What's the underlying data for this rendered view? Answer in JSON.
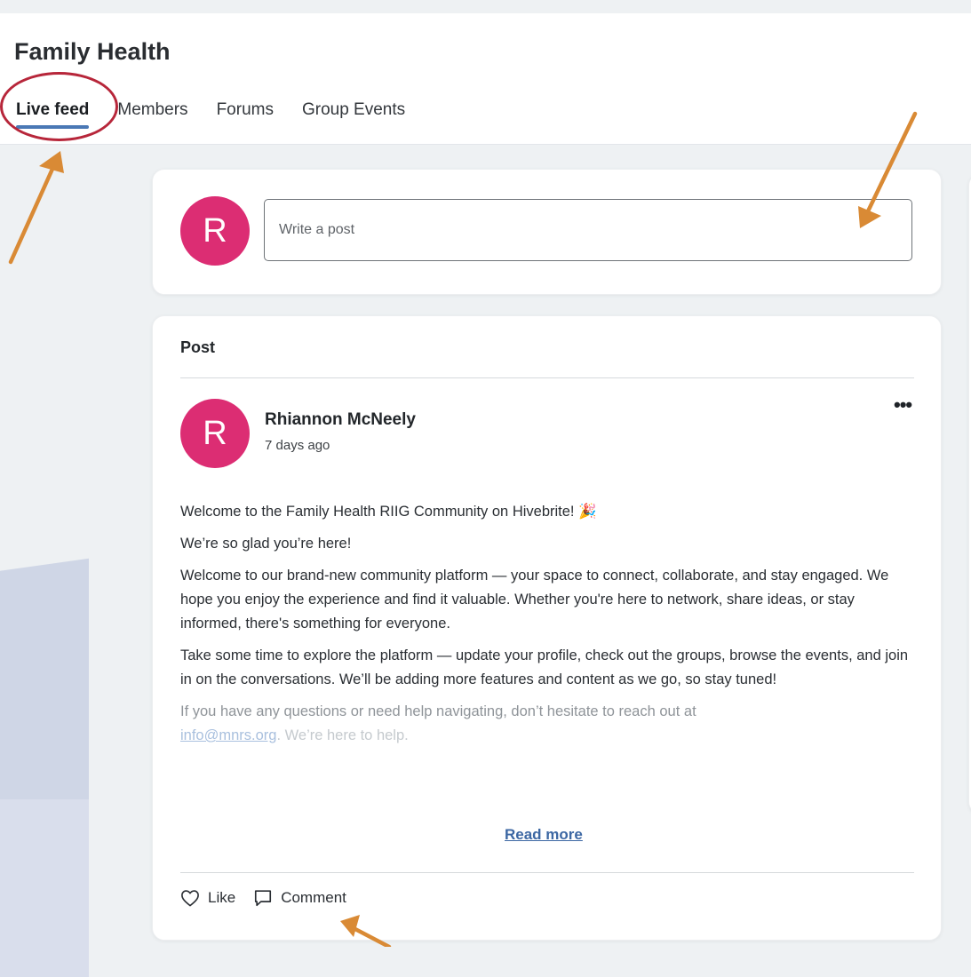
{
  "header": {
    "group_title": "Family Health",
    "tabs": [
      {
        "label": "Live feed",
        "active": true
      },
      {
        "label": "Members"
      },
      {
        "label": "Forums"
      },
      {
        "label": "Group Events"
      }
    ]
  },
  "composer": {
    "avatar_initial": "R",
    "placeholder": "Write a post"
  },
  "post": {
    "section_label": "Post",
    "author": {
      "initial": "R",
      "name": "Rhiannon McNeely"
    },
    "time": "7 days ago",
    "more_icon": "ellipsis-icon",
    "paragraphs": [
      "Welcome to the Family Health RIIG Community on Hivebrite! 🎉",
      "We’re so glad you’re here!",
      "Welcome to our brand-new community platform — your space to connect, collaborate, and stay engaged. We hope you enjoy the experience and find it valuable. Whether you're here to network, share ideas, or stay informed, there's something for everyone.",
      "Take some time to explore the platform — update your profile, check out the groups, browse the events, and join in on the conversations. We’ll be adding more features and content as we go, so stay tuned!",
      "If you have any questions or need help navigating, don’t hesitate to reach out at"
    ],
    "email": "info@mnrs.org",
    "email_suffix": ". We’re here to help.",
    "read_more": "Read more",
    "actions": {
      "like": "Like",
      "comment": "Comment"
    }
  },
  "colors": {
    "avatar": "#dc2d73",
    "tab_underline": "#4a78b5",
    "highlight_ring": "#b7263a",
    "annotation_arrow": "#d98a35",
    "link": "#3c67a3"
  }
}
